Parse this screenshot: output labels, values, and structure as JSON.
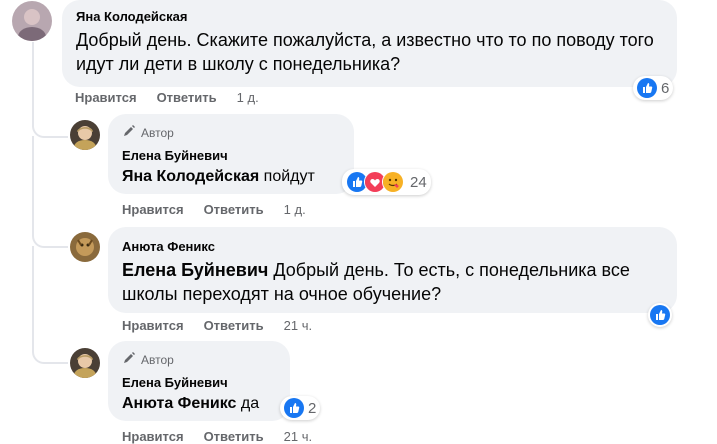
{
  "comments": [
    {
      "author": "Яна Колодейская",
      "text": "Добрый день. Скажите пожалуйста, а известно что то по поводу того идут ли дети в школу с понедельника?",
      "actions": {
        "like": "Нравится",
        "reply": "Ответить",
        "time": "1 д."
      },
      "reactions": {
        "count": "6"
      }
    },
    {
      "author_badge": "Автор",
      "author": "Елена Буйневич",
      "mention": "Яна Колодейская",
      "text": "пойдут",
      "actions": {
        "like": "Нравится",
        "reply": "Ответить",
        "time": "1 д."
      },
      "reactions": {
        "count": "24"
      }
    },
    {
      "author": "Анюта Феникс",
      "mention": "Елена Буйневич",
      "text": "Добрый день. То есть, с понедельника все школы переходят на очное обучение?",
      "actions": {
        "like": "Нравится",
        "reply": "Ответить",
        "time": "21 ч."
      }
    },
    {
      "author_badge": "Автор",
      "author": "Елена Буйневич",
      "mention": "Анюта Феникс",
      "text": "да",
      "actions": {
        "like": "Нравится",
        "reply": "Ответить",
        "time": "21 ч."
      },
      "reactions": {
        "count": "2"
      }
    }
  ],
  "colors": {
    "bubble": "#f0f2f5",
    "secondary_text": "#65676b",
    "like_blue": "#1877f2",
    "love_red": "#f33e58",
    "care_yellow": "#f7b125"
  },
  "icons": [
    "pencil-icon",
    "like-reaction-icon",
    "love-reaction-icon",
    "care-reaction-icon"
  ]
}
